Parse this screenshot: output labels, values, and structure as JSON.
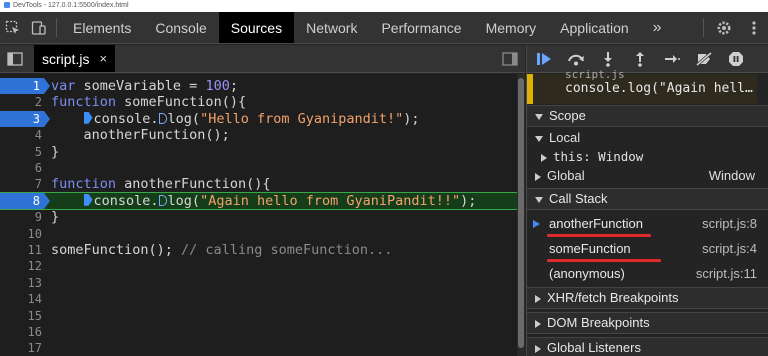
{
  "window": {
    "title": "DevTools - 127.0.0.1:5500/index.html"
  },
  "tabs": [
    "Elements",
    "Console",
    "Sources",
    "Network",
    "Performance",
    "Memory",
    "Application"
  ],
  "tabs_more": "»",
  "active_tab": "Sources",
  "file_tab": {
    "name": "script.js",
    "close": "×"
  },
  "editor": {
    "lines": [
      {
        "n": "1",
        "breakpoint": true
      },
      {
        "n": "2"
      },
      {
        "n": "3",
        "breakpoint": true
      },
      {
        "n": "4"
      },
      {
        "n": "5"
      },
      {
        "n": "6"
      },
      {
        "n": "7"
      },
      {
        "n": "8",
        "breakpoint": true,
        "exec": true
      },
      {
        "n": "9"
      },
      {
        "n": "10"
      },
      {
        "n": "11"
      },
      {
        "n": "12"
      },
      {
        "n": "13"
      },
      {
        "n": "14"
      },
      {
        "n": "15"
      },
      {
        "n": "16"
      },
      {
        "n": "17"
      }
    ],
    "code": {
      "l1_kw": "var",
      "l1_rest": " someVariable = ",
      "l1_num": "100",
      "l1_end": ";",
      "l2_kw": "function",
      "l2_rest": " someFunction(){",
      "l3_a": "console.",
      "l3_b": "log(",
      "l3_str": "\"Hello from Gyanipandit!\"",
      "l3_end": ");",
      "l4": "    anotherFunction();",
      "l5": "}",
      "l7_kw": "function",
      "l7_rest": " anotherFunction(){",
      "l8_a": "console.",
      "l8_b": "log(",
      "l8_str": "\"Again hello from GyaniPandit!!\"",
      "l8_end": ");",
      "l9": "}",
      "l11_code": "someFunction();",
      "l11_cmt": " // calling someFunction..."
    }
  },
  "paused": {
    "file_label": "script.js",
    "code": "console.log(\"Again hell…"
  },
  "scope": {
    "title": "Scope",
    "local_title": "Local",
    "this_key": "this",
    "this_val": "Window",
    "global_title": "Global",
    "global_val": "Window"
  },
  "call_stack": {
    "title": "Call Stack",
    "frames": [
      {
        "name": "anotherFunction",
        "loc": "script.js:8",
        "current": true
      },
      {
        "name": "someFunction",
        "loc": "script.js:4"
      },
      {
        "name": "(anonymous)",
        "loc": "script.js:11"
      }
    ]
  },
  "sections": [
    "XHR/fetch Breakpoints",
    "DOM Breakpoints",
    "Global Listeners"
  ],
  "colors": {
    "breakpoint": "#2f73d9",
    "exec_line": "#163d1a",
    "annotation": "#e12b2b",
    "paused": "#e0b200"
  }
}
